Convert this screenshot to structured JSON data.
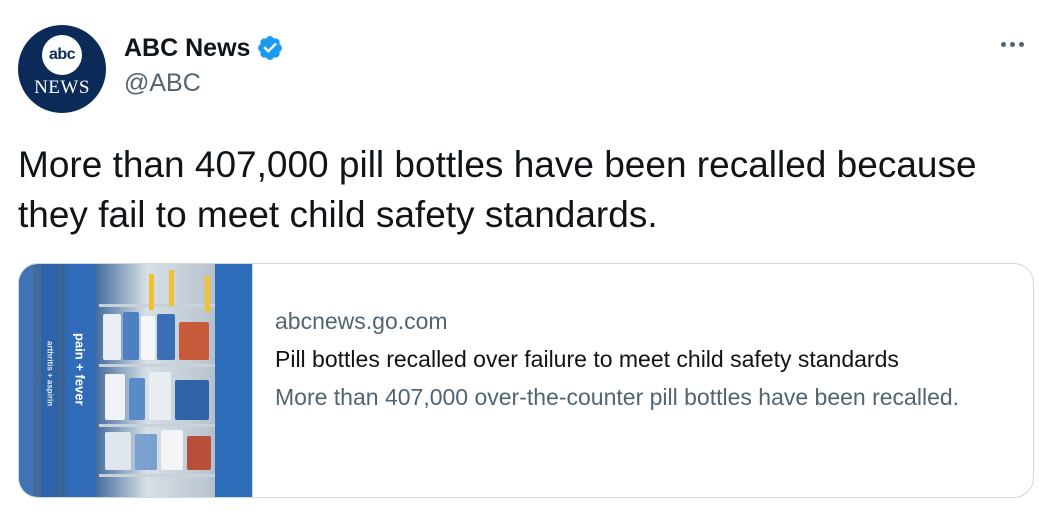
{
  "author": {
    "avatar_text_top": "abc",
    "avatar_text_bottom": "NEWS",
    "name": "ABC News",
    "handle": "@ABC",
    "verified_icon": "verified-badge-icon",
    "verified_color": "#1d9bf0"
  },
  "tweet": {
    "text": "More than 407,000 pill bottles have been recalled because they fail to meet child safety standards."
  },
  "card": {
    "image_label_main": "pain + fever",
    "image_label_side": "arthritis + aspirin",
    "domain": "abcnews.go.com",
    "title": "Pill bottles recalled over failure to meet child safety standards",
    "description": "More than 407,000 over-the-counter pill bottles have been recalled."
  },
  "colors": {
    "text_primary": "#0f1419",
    "text_secondary": "#536471",
    "border": "#cfd9de",
    "avatar_bg": "#0b2a57"
  }
}
